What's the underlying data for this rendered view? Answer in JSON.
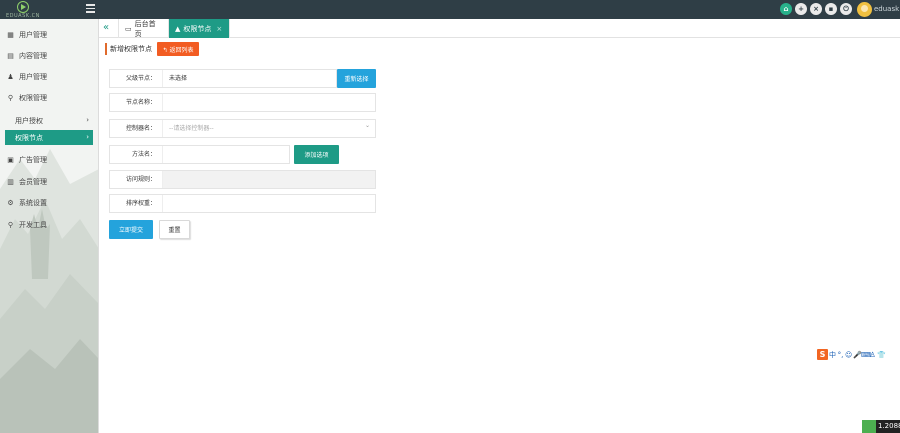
{
  "app": {
    "logo_text": "EDUASK.CN",
    "username": "eduask"
  },
  "top_icons": [
    "home-icon",
    "plus-icon",
    "close-icon",
    "message-icon",
    "power-icon"
  ],
  "sidebar": {
    "items": [
      {
        "label": "用户管理",
        "icon": "▦"
      },
      {
        "label": "内容管理",
        "icon": "▤"
      },
      {
        "label": "用户管理",
        "icon": "♟"
      },
      {
        "label": "权限管理",
        "icon": "⚲"
      },
      {
        "label": "广告管理",
        "icon": "▣"
      },
      {
        "label": "会员管理",
        "icon": "▥"
      },
      {
        "label": "系统设置",
        "icon": "⚙"
      },
      {
        "label": "开发工具",
        "icon": "⚲"
      }
    ],
    "sub_items": [
      {
        "label": "用户授权",
        "chevron": "›"
      },
      {
        "label": "权限节点",
        "chevron": "›"
      }
    ]
  },
  "tabs": {
    "collapse": "«",
    "home": {
      "label": "后台首页",
      "icon": "▭"
    },
    "active": {
      "label": "权限节点",
      "icon": "▲",
      "close": "×"
    }
  },
  "page": {
    "title": "新增权限节点",
    "back_label": "↰ 返回列表"
  },
  "form": {
    "parent": {
      "label": "父级节点：",
      "value": "未选择",
      "button": "重新选择"
    },
    "node_name": {
      "label": "节点名称：",
      "value": ""
    },
    "controller": {
      "label": "控制器名：",
      "placeholder": "--请选择控制器--",
      "arrow": "⌄"
    },
    "method": {
      "label": "方法名：",
      "value": "",
      "button": "添加选项"
    },
    "access_rule": {
      "label": "访问规则：",
      "value": ""
    },
    "sort": {
      "label": "排序权重：",
      "value": ""
    },
    "submit_label": "立即提交",
    "reset_label": "重置"
  },
  "ime": {
    "logo": "S",
    "items": [
      "中",
      "°,",
      "☺",
      "🎤",
      "⌨",
      "♙",
      "👕"
    ]
  },
  "status": {
    "text": "1.2088"
  }
}
